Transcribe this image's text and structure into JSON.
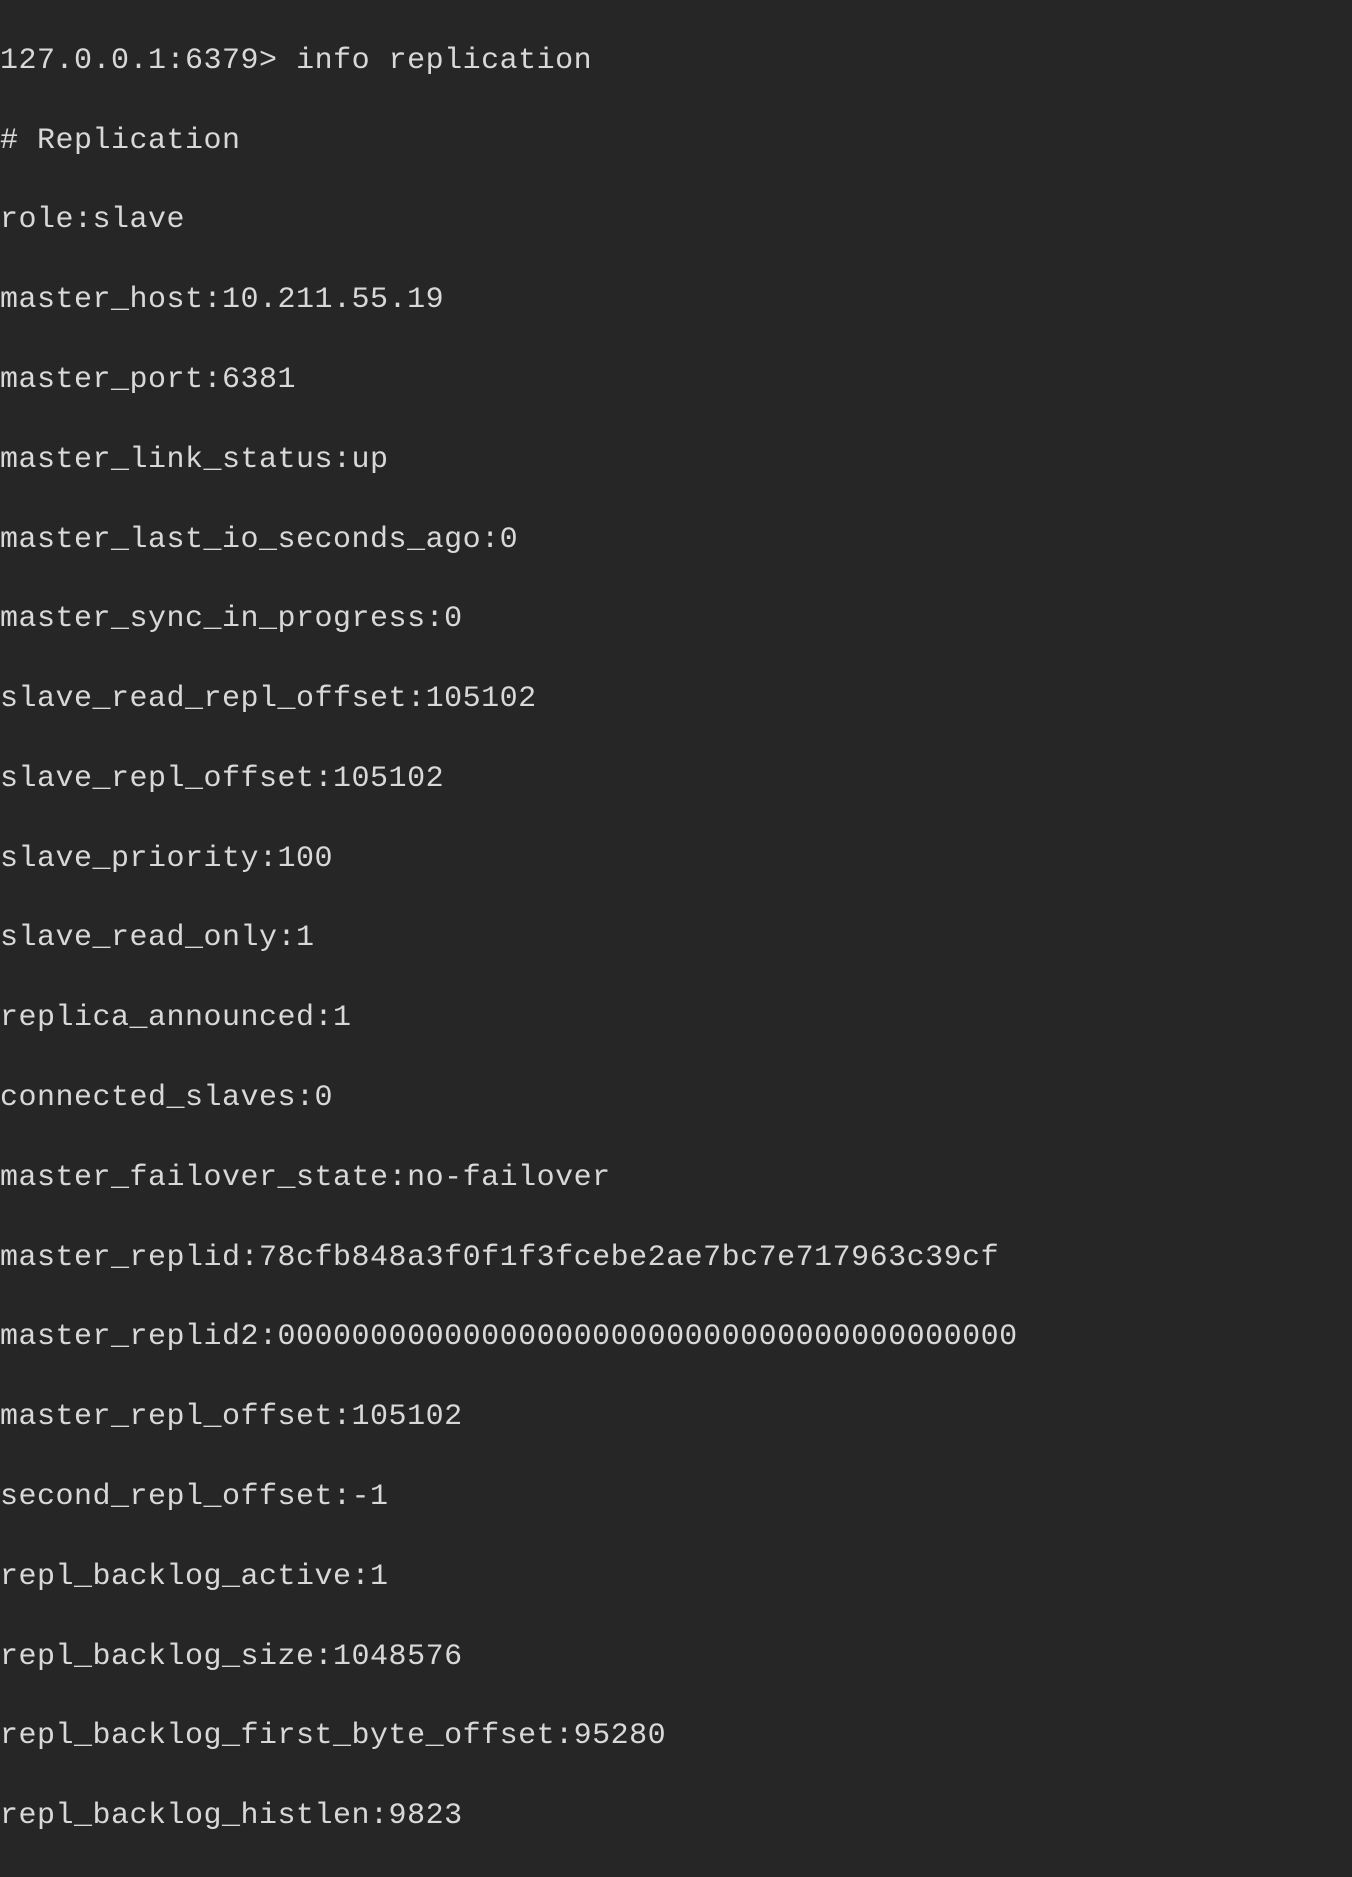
{
  "terminal": {
    "prompt": "127.0.0.1:6379>",
    "command": "info replication",
    "header": "# Replication",
    "lines": [
      "role:slave",
      "master_host:10.211.55.19",
      "master_port:6381",
      "master_link_status:up",
      "master_last_io_seconds_ago:0",
      "master_sync_in_progress:0",
      "slave_read_repl_offset:105102",
      "slave_repl_offset:105102",
      "slave_priority:100",
      "slave_read_only:1",
      "replica_announced:1",
      "connected_slaves:0",
      "master_failover_state:no-failover",
      "master_replid:78cfb848a3f0f1f3fcebe2ae7bc7e717963c39cf",
      "master_replid2:0000000000000000000000000000000000000000",
      "master_repl_offset:105102",
      "second_repl_offset:-1",
      "repl_backlog_active:1",
      "repl_backlog_size:1048576",
      "repl_backlog_first_byte_offset:95280",
      "repl_backlog_histlen:9823"
    ]
  }
}
